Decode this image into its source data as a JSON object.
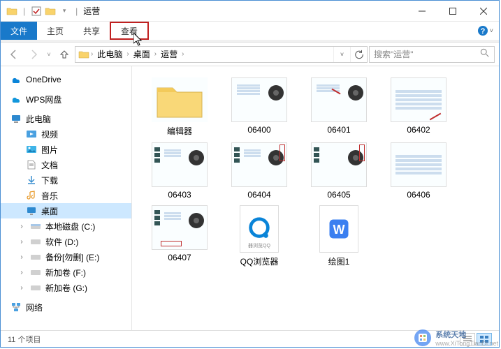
{
  "title": "运营",
  "qat": {
    "icon1": "folder-icon",
    "icon2": "check-icon",
    "icon3": "folder-small-icon"
  },
  "tabs": {
    "file": "文件",
    "home": "主页",
    "share": "共享",
    "view": "查看"
  },
  "nav": {
    "segments": [
      "此电脑",
      "桌面",
      "运营"
    ],
    "search_placeholder": "搜索\"运营\""
  },
  "sidebar": {
    "onedrive": "OneDrive",
    "wps": "WPS网盘",
    "thispc": "此电脑",
    "videos": "视频",
    "pictures": "图片",
    "documents": "文档",
    "downloads": "下载",
    "music": "音乐",
    "desktop": "桌面",
    "diskC": "本地磁盘 (C:)",
    "diskD": "软件 (D:)",
    "diskE": "备份[勿删] (E:)",
    "diskF": "新加卷 (F:)",
    "diskG": "新加卷 (G:)",
    "network": "网络"
  },
  "items": [
    {
      "name": "编辑器",
      "type": "folder"
    },
    {
      "name": "06400",
      "type": "video"
    },
    {
      "name": "06401",
      "type": "video"
    },
    {
      "name": "06402",
      "type": "video"
    },
    {
      "name": "06403",
      "type": "video"
    },
    {
      "name": "06404",
      "type": "video"
    },
    {
      "name": "06405",
      "type": "video"
    },
    {
      "name": "06406",
      "type": "video"
    },
    {
      "name": "06407",
      "type": "video"
    },
    {
      "name": "QQ浏览器",
      "type": "qq"
    },
    {
      "name": "绘图1",
      "type": "doc"
    }
  ],
  "status": {
    "count": "11 个项目"
  },
  "watermark": {
    "top": "系统天地",
    "bottom": "www.XiTongTianDi.net"
  }
}
